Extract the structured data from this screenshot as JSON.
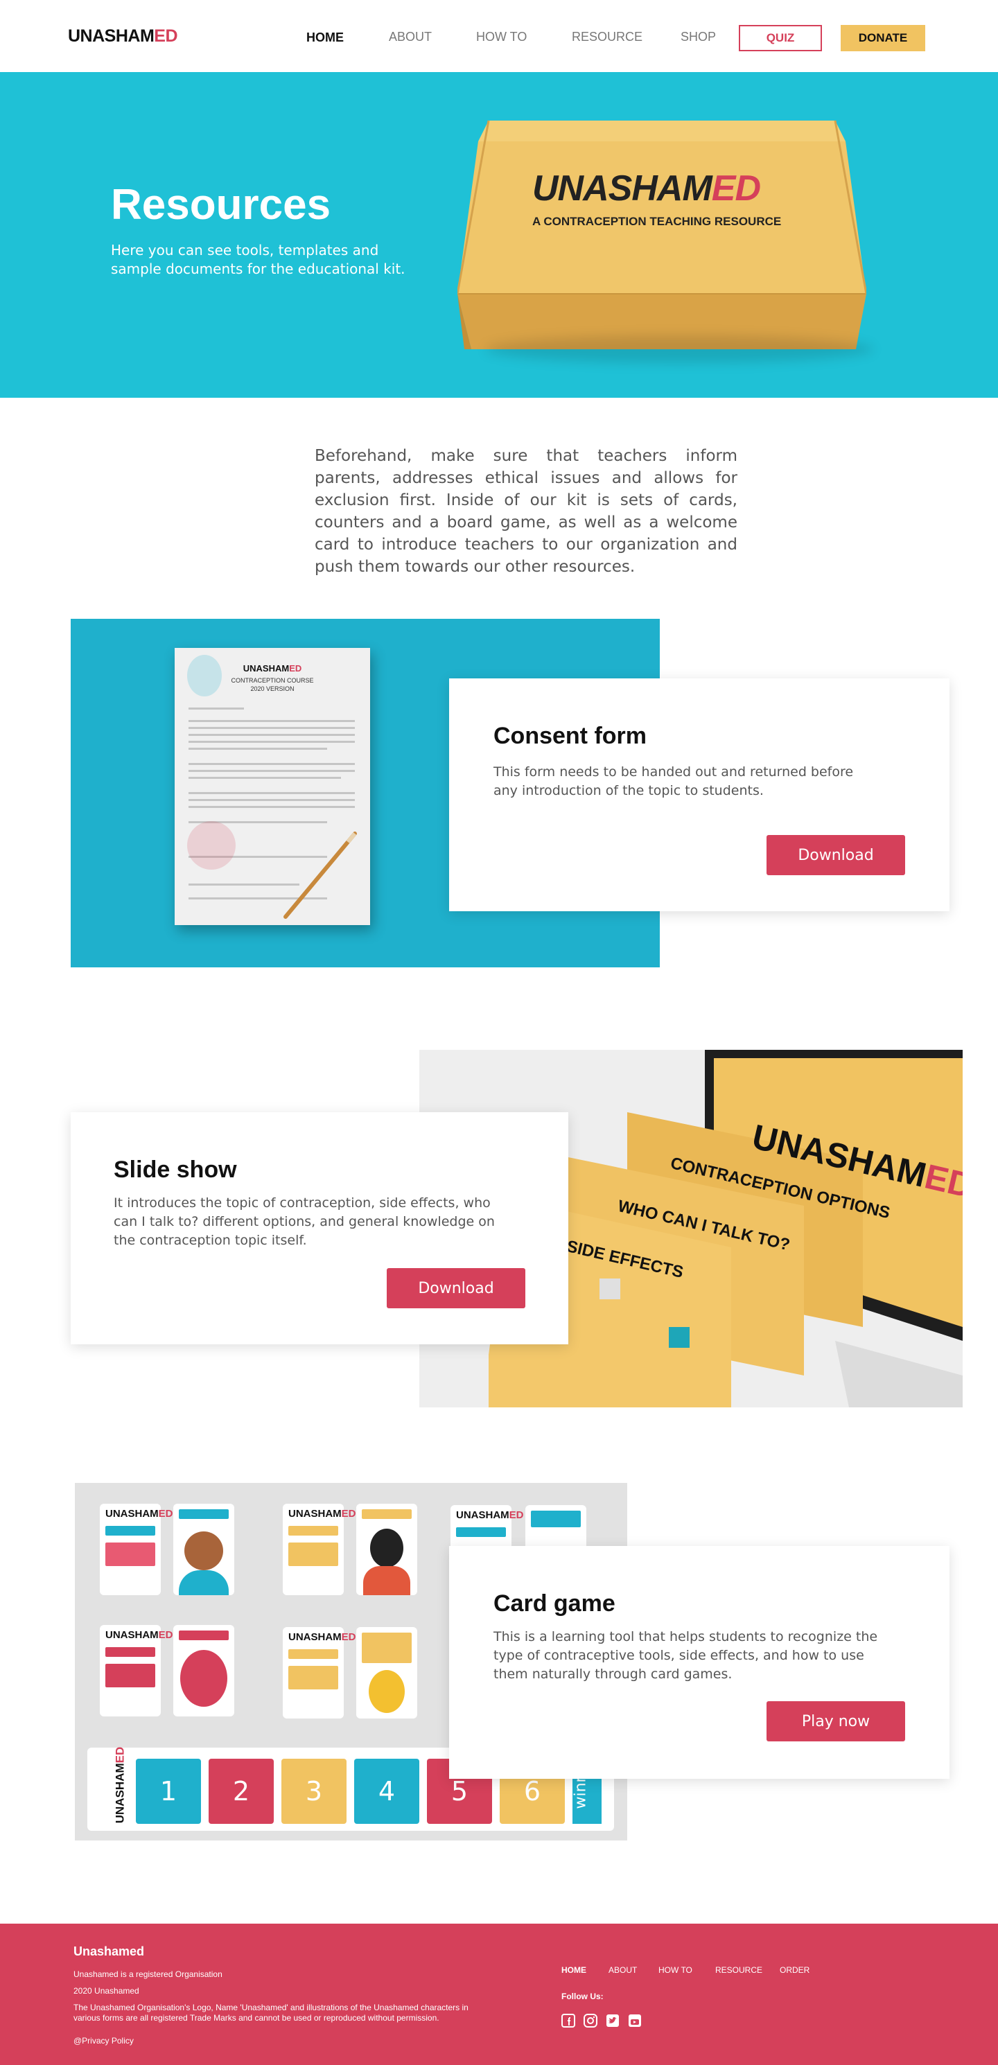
{
  "nav": {
    "logo_main": "UNASHAM",
    "logo_accent": "ED",
    "links": [
      "HOME",
      "ABOUT",
      "HOW TO",
      "RESOURCE",
      "SHOP"
    ],
    "quiz": "QUIZ",
    "donate": "DONATE"
  },
  "hero": {
    "title": "Resources",
    "subtitle": "Here you can see tools, templates and sample documents for the educational kit.",
    "box_brand_main": "UNASHAM",
    "box_brand_accent": "ED",
    "box_tagline": "A CONTRACEPTION TEACHING RESOURCE"
  },
  "intro": "Beforehand, make sure that teachers inform parents, addresses ethical issues and allows for exclusion first. Inside of our kit is sets of cards, counters and a board game, as well as a welcome card to introduce teachers to our organization and push them towards our other resources.",
  "consent": {
    "title": "Consent form",
    "text": "This form needs to be handed out and returned before any introduction of the topic to students.",
    "button": "Download",
    "paper_brand_main": "UNASHAM",
    "paper_brand_accent": "ED",
    "paper_course": "CONTRACEPTION COURSE",
    "paper_version": "2020 VERSION"
  },
  "slides": {
    "title": "Slide show",
    "text": "It introduces the topic of contraception, side effects, who can I talk to? different options, and general knowledge on the contraception topic itself.",
    "button": "Download",
    "screen_brand_main": "UNASHAM",
    "screen_brand_accent": "ED",
    "slide_titles": [
      "CONTRACEPTION OPTIONS",
      "WHO CAN I TALK TO?",
      "SIDE EFFECTS"
    ]
  },
  "cardgame": {
    "title": "Card game",
    "text": "This is a learning tool that helps students to recognize the type of contraceptive tools, side effects, and how to use them naturally through card games.",
    "button": "Play now",
    "brand_main": "UNASHAM",
    "brand_accent": "ED",
    "tiles": [
      "1",
      "2",
      "3",
      "4",
      "5",
      "6"
    ],
    "win_label": "winn"
  },
  "footer": {
    "title": "Unashamed",
    "lines": [
      "Unashamed is a registered Organisation",
      "2020 Unashamed",
      "The Unashamed Organisation's Logo, Name 'Unashamed' and illustrations of the Unashamed characters in various forms are all registered Trade Marks and cannot be used or reproduced without permission.",
      "@Privacy Policy"
    ],
    "nav": [
      "HOME",
      "ABOUT",
      "HOW TO",
      "RESOURCE",
      "ORDER"
    ],
    "follow": "Follow Us:",
    "social_icons": [
      "facebook-icon",
      "instagram-icon",
      "twitter-icon",
      "youtube-icon"
    ]
  },
  "colors": {
    "teal": "#1fc1d6",
    "red": "#d5405a",
    "yellow": "#f1c361"
  }
}
